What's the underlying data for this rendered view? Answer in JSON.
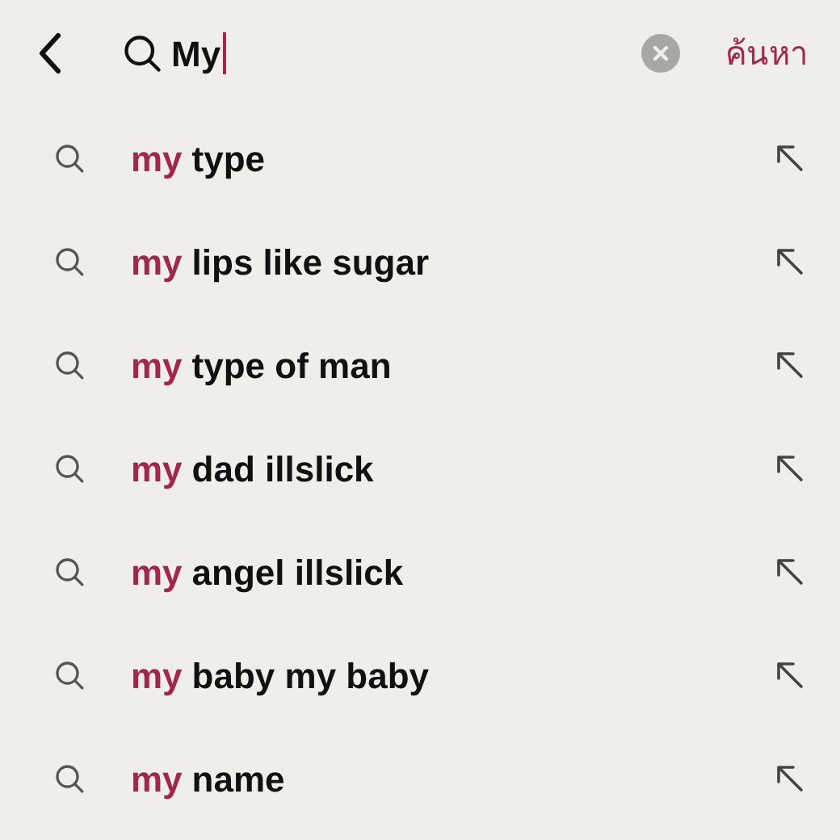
{
  "search": {
    "value": "My",
    "action": "ค้นหา"
  },
  "suggestions": [
    {
      "match": "my",
      "rest": "type"
    },
    {
      "match": "my",
      "rest": "lips like sugar"
    },
    {
      "match": "my",
      "rest": "type of man"
    },
    {
      "match": "my",
      "rest": "dad illslick"
    },
    {
      "match": "my",
      "rest": "angel illslick"
    },
    {
      "match": "my",
      "rest": "baby my baby"
    },
    {
      "match": "my",
      "rest": "name"
    }
  ]
}
